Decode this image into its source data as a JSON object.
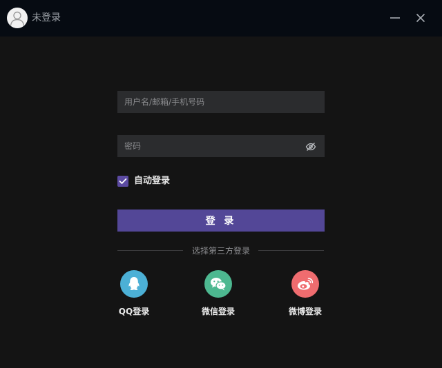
{
  "titlebar": {
    "user_name": "未登录",
    "avatar_icon": "user-icon",
    "minimize_icon": "minimize-icon",
    "close_icon": "close-icon",
    "background": "#060b12"
  },
  "form": {
    "username_placeholder": "用户名/邮箱/手机号码",
    "username_value": "",
    "password_placeholder": "密码",
    "password_value": "",
    "password_toggle_icon": "eye-off-icon",
    "auto_login_label": "自动登录",
    "auto_login_checked": true,
    "login_button_label": "登 录"
  },
  "third_party": {
    "divider_text": "选择第三方登录",
    "providers": [
      {
        "label": "QQ登录",
        "icon": "qq-icon",
        "color": "#4cb0d6"
      },
      {
        "label": "微信登录",
        "icon": "wechat-icon",
        "color": "#4db890"
      },
      {
        "label": "微博登录",
        "icon": "weibo-icon",
        "color": "#ef6c6f"
      }
    ]
  },
  "colors": {
    "accent": "#534797",
    "checkbox": "#5b4aa1",
    "background": "#141414",
    "field": "#2b2c2e"
  }
}
